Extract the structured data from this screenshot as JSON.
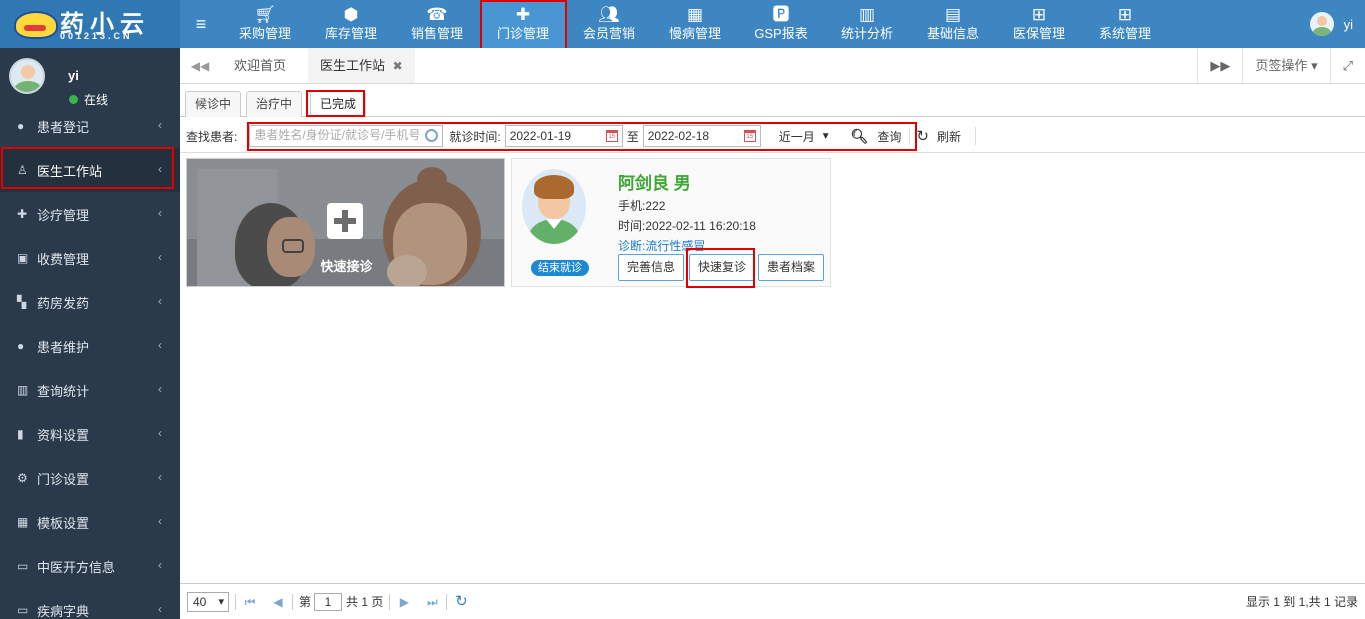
{
  "app": {
    "logo_text": "药小云",
    "logo_sub": "001213.CN"
  },
  "top_nav": [
    {
      "label": "采购管理",
      "icon": "cart-icon"
    },
    {
      "label": "库存管理",
      "icon": "cube-icon"
    },
    {
      "label": "销售管理",
      "icon": "phone-icon"
    },
    {
      "label": "门诊管理",
      "icon": "medkit-icon",
      "active": true
    },
    {
      "label": "会员营销",
      "icon": "users-icon"
    },
    {
      "label": "慢病管理",
      "icon": "hospital-icon"
    },
    {
      "label": "GSP报表",
      "icon": "file-p-icon"
    },
    {
      "label": "统计分析",
      "icon": "bar-chart-icon"
    },
    {
      "label": "基础信息",
      "icon": "book-icon"
    },
    {
      "label": "医保管理",
      "icon": "windows-icon"
    },
    {
      "label": "系统管理",
      "icon": "windows-icon"
    }
  ],
  "top_user": {
    "name": "yi"
  },
  "sidebar": {
    "user_name": "yi",
    "status": "在线",
    "items": [
      {
        "label": "患者登记",
        "icon": "user-icon"
      },
      {
        "label": "医生工作站",
        "icon": "doctor-icon",
        "active": true
      },
      {
        "label": "诊疗管理",
        "icon": "medkit-icon"
      },
      {
        "label": "收费管理",
        "icon": "money-icon"
      },
      {
        "label": "药房发药",
        "icon": "map-icon"
      },
      {
        "label": "患者维护",
        "icon": "user-icon"
      },
      {
        "label": "查询统计",
        "icon": "bar-chart-icon"
      },
      {
        "label": "资料设置",
        "icon": "file-icon"
      },
      {
        "label": "门诊设置",
        "icon": "gears-icon"
      },
      {
        "label": "模板设置",
        "icon": "grid-icon"
      },
      {
        "label": "中医开方信息",
        "icon": "desktop-icon"
      },
      {
        "label": "疾病字典",
        "icon": "desktop-icon"
      }
    ]
  },
  "tabs": {
    "home": "欢迎首页",
    "current": "医生工作站",
    "page_ops": "页签操作"
  },
  "subtabs": [
    "候诊中",
    "治疗中",
    "已完成"
  ],
  "toolbar": {
    "find_label": "查找患者:",
    "search_placeholder": "患者姓名/身份证/就诊号/手机号",
    "visit_time_label": "就诊时间:",
    "date_from": "2022-01-19",
    "to_label": "至",
    "date_to": "2022-02-18",
    "range_select": "近一月",
    "query_button": "查询",
    "refresh_button": "刷新"
  },
  "quick_card": {
    "label": "快速接诊"
  },
  "patient_card": {
    "name": "阿剑良 男",
    "phone_label": "手机:",
    "phone": "222",
    "time_label": "时间:",
    "time": "2022-02-11 16:20:18",
    "diag_label": "诊断:",
    "diag": "流行性感冒",
    "status_badge": "结束就诊",
    "buttons": {
      "complete_info": "完善信息",
      "quick_revisit": "快速复诊",
      "patient_file": "患者档案"
    }
  },
  "pager": {
    "page_size": "40",
    "page_label_before": "第",
    "page": "1",
    "page_label_after": "共 1 页",
    "info": "显示 1 到 1,共 1 记录"
  },
  "colors": {
    "topbar": "#3d86c1",
    "sidebar": "#2b3a4a",
    "highlight": "#e00000",
    "patient_name": "#3aa832",
    "badge": "#1e88d3"
  }
}
